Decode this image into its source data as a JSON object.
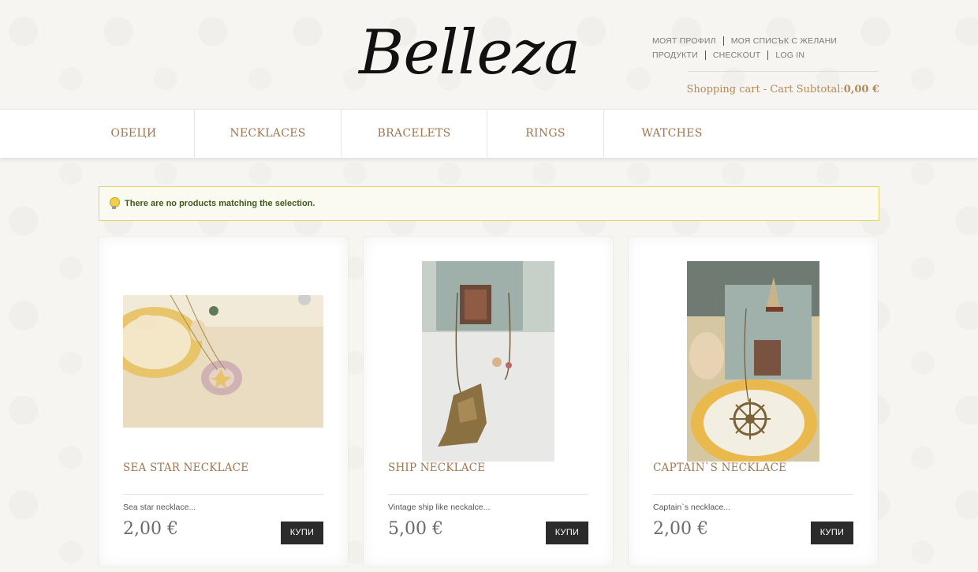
{
  "header": {
    "logo": "Belleza",
    "links_row1": [
      "МОЯТ ПРОФИЛ",
      "МОЯ СПИСЪК С ЖЕЛАНИ"
    ],
    "links_row2": [
      "ПРОДУКТИ",
      "CHECKOUT",
      "LOG IN"
    ],
    "cart_label": "Shopping cart - Cart Subtotal:",
    "cart_total": "0,00 €"
  },
  "nav": {
    "items": [
      "ОБЕЦИ",
      "NECKLACES",
      "BRACELETS",
      "RINGS",
      "WATCHES"
    ]
  },
  "notice": {
    "text": "There are no products matching the selection."
  },
  "products": [
    {
      "name": "SEA STAR NECKLACE",
      "description": "Sea star necklace...",
      "price": "2,00 €",
      "buy_label": "КУПИ"
    },
    {
      "name": "SHIP NECKLACE",
      "description": "Vintage ship like neckalce...",
      "price": "5,00 €",
      "buy_label": "КУПИ"
    },
    {
      "name": "CAPTAIN`S NECKLACE",
      "description": "Captain`s necklace...",
      "price": "2,00 €",
      "buy_label": "КУПИ"
    }
  ],
  "colors": {
    "accent": "#a07650",
    "cart_text": "#b28a5a",
    "notice_border": "#e6d46a",
    "notice_text": "#3d5a1e",
    "button_bg": "#2b2b2b"
  }
}
